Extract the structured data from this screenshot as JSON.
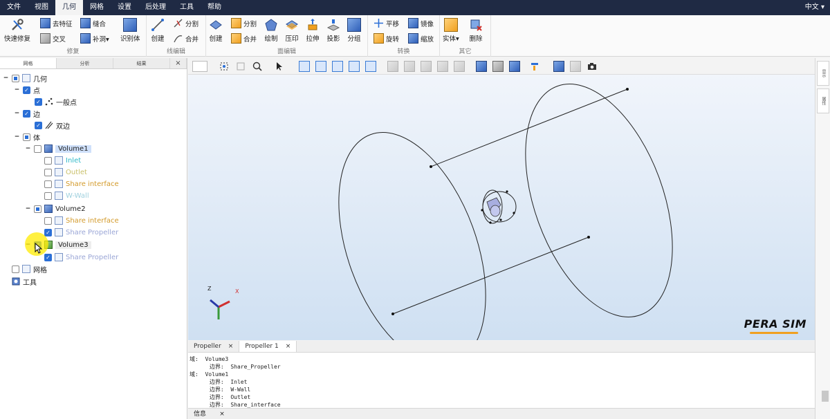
{
  "menu": {
    "items": [
      {
        "label": "文件"
      },
      {
        "label": "视图"
      },
      {
        "label": "几何",
        "active": true
      },
      {
        "label": "网格"
      },
      {
        "label": "设置"
      },
      {
        "label": "后处理"
      },
      {
        "label": "工具"
      },
      {
        "label": "帮助"
      }
    ],
    "language": "中文 ▾"
  },
  "ribbon": {
    "groups": {
      "repair": {
        "title": "修复",
        "quick_repair": "快速修复",
        "remove_feature": "去特征",
        "intersect": "交叉",
        "combine": "缝合",
        "fill_hole": "补洞▾",
        "identify_body": "识别体"
      },
      "line_edit": {
        "title": "线编辑",
        "create": "创建",
        "split": "分割",
        "merge": "合并"
      },
      "face_edit": {
        "title": "面编辑",
        "create": "创建",
        "split": "分割",
        "merge": "合并",
        "draw": "绘制",
        "imprint": "压印",
        "extrude": "拉伸",
        "project": "投影",
        "group": "分组"
      },
      "transform": {
        "title": "转换",
        "translate": "平移",
        "mirror": "镜像",
        "rotate": "旋转",
        "scale": "缩放"
      },
      "other": {
        "title": "其它",
        "solid": "实体▾",
        "delete": "删除"
      }
    }
  },
  "left_tabs": [
    "网格",
    "分析",
    "结果",
    "×"
  ],
  "tree": {
    "geometry": "几何",
    "points": "点",
    "general_point": "一般点",
    "edges": "边",
    "double_edge": "双边",
    "bodies": "体",
    "volume1": "Volume1",
    "v1_inlet": "Inlet",
    "v1_outlet": "Outlet",
    "v1_share_interface": "Share interface",
    "v1_wwall": "W-Wall",
    "volume2": "Volume2",
    "v2_share_interface": "Share interface",
    "v2_share_propeller": "Share Propeller",
    "volume3": "Volume3",
    "v3_share_propeller": "Share Propeller",
    "mesh": "网格",
    "tools": "工具"
  },
  "face_colors": {
    "inlet": "#2fb8c8",
    "outlet": "#c9c06a",
    "share_interface": "#d39a2a",
    "wwall": "#9ed0de",
    "share_propeller": "#9aa6d6"
  },
  "axis": {
    "z": "Z",
    "x": "X"
  },
  "logo": "PERA SIM",
  "right_tabs": [
    "显示",
    "属性"
  ],
  "doc_tabs": [
    {
      "label": "Propeller",
      "close": "×"
    },
    {
      "label": "Propeller 1",
      "close": "×"
    }
  ],
  "console": [
    "域:  Volume3",
    "      边界:  Share_Propeller",
    "域:  Volume1",
    "      边界:  Inlet",
    "      边界:  W-Wall",
    "      边界:  Outlet",
    "      边界:  Share_interface"
  ],
  "info_tab": {
    "label": "信息",
    "close": "×"
  }
}
